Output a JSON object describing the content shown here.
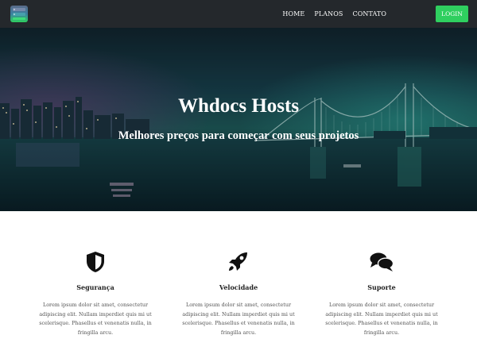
{
  "nav": {
    "links": [
      "HOME",
      "PLANOS",
      "CONTATO"
    ],
    "login_label": "LOGIN"
  },
  "hero": {
    "title": "Whdocs Hosts",
    "subtitle": "Melhores preços para começar com seus projetos"
  },
  "features": [
    {
      "icon": "shield-icon",
      "title": "Segurança",
      "description": "Lorem ipsum dolor sit amet, consectetur adipiscing elit. Nullam imperdiet quis mi ut scelerisque. Phasellus et venenatis nulla, in fringilla arcu."
    },
    {
      "icon": "rocket-icon",
      "title": "Velocidade",
      "description": "Lorem ipsum dolor sit amet, consectetur adipiscing elit. Nullam imperdiet quis mi ut scelerisque. Phasellus et venenatis nulla, in fringilla arcu."
    },
    {
      "icon": "chat-bubbles-icon",
      "title": "Suporte",
      "description": "Lorem ipsum dolor sit amet, consectetur adipiscing elit. Nullam imperdiet quis mi ut scelerisque. Phasellus et venenatis nulla, in fringilla arcu."
    }
  ],
  "colors": {
    "navbar": "#24282c",
    "login_button": "#2fcf5f",
    "hero_overlay": "#0b2a33"
  }
}
